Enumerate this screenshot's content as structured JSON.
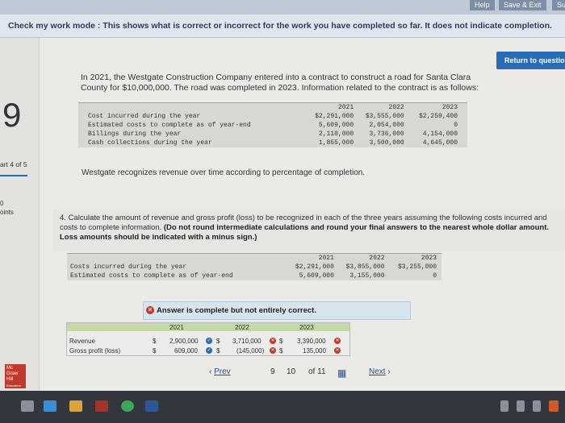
{
  "topbar": {
    "help": "Help",
    "save_exit": "Save & Exit",
    "submit": "Su"
  },
  "mode_text": "Check my work mode : This shows what is correct or incorrect for the work you have completed so far. It does not indicate completion.",
  "left": {
    "question_number": "9",
    "part": "art 4 of 5",
    "points_num": "0",
    "points_label": "oints"
  },
  "return_button": "Return to questio",
  "intro_text": "In 2021, the Westgate Construction Company entered into a contract to construct a road for Santa Clara County for $10,000,000. The road was completed in 2023. Information related to the contract is as follows:",
  "table1": {
    "years": [
      "2021",
      "2022",
      "2023"
    ],
    "rows": [
      {
        "label": "Cost incurred during the year",
        "values": [
          "$2,291,000",
          "$3,555,000",
          "$2,259,400"
        ]
      },
      {
        "label": "Estimated costs to complete as of year-end",
        "values": [
          "5,609,000",
          "2,054,000",
          "0"
        ]
      },
      {
        "label": "Billings during the year",
        "values": [
          "2,110,000",
          "3,736,000",
          "4,154,000"
        ]
      },
      {
        "label": "Cash collections during the year",
        "values": [
          "1,855,000",
          "3,500,000",
          "4,645,000"
        ]
      }
    ]
  },
  "recognize_text": "Westgate recognizes revenue over time according to percentage of completion.",
  "question": {
    "plain": "4. Calculate the amount of revenue and gross profit (loss) to be recognized in each of the three years assuming the following costs incurred and costs to complete information.",
    "bold": "(Do not round intermediate calculations and round your final answers to the nearest whole dollar amount. Loss amounts should be indicated with a minus sign.)"
  },
  "table2": {
    "years": [
      "2021",
      "2022",
      "2023"
    ],
    "rows": [
      {
        "label": "Costs incurred during the year",
        "values": [
          "$2,291,000",
          "$3,855,000",
          "$3,255,000"
        ]
      },
      {
        "label": "Estimated costs to complete as of year-end",
        "values": [
          "5,609,000",
          "3,155,000",
          "0"
        ]
      }
    ]
  },
  "answer_status": "Answer is complete but not entirely correct.",
  "answer_table": {
    "years": [
      "2021",
      "2022",
      "2023"
    ],
    "rows": [
      {
        "label": "Revenue",
        "d1": "$",
        "v1": "2,900,000",
        "d2": "$",
        "v2": "3,710,000",
        "d3": "$",
        "v3": "3,390,000"
      },
      {
        "label": "Gross profit (loss)",
        "d1": "$",
        "v1": "609,000",
        "d2": "$",
        "v2": "(145,000)",
        "d3": "$",
        "v3": "135,000"
      }
    ]
  },
  "nav": {
    "prev": "Prev",
    "page": "9",
    "page_next": "10",
    "of": "of 11",
    "next": "Next"
  },
  "logo_text": [
    "Mc",
    "Graw",
    "Hill",
    "Education"
  ]
}
